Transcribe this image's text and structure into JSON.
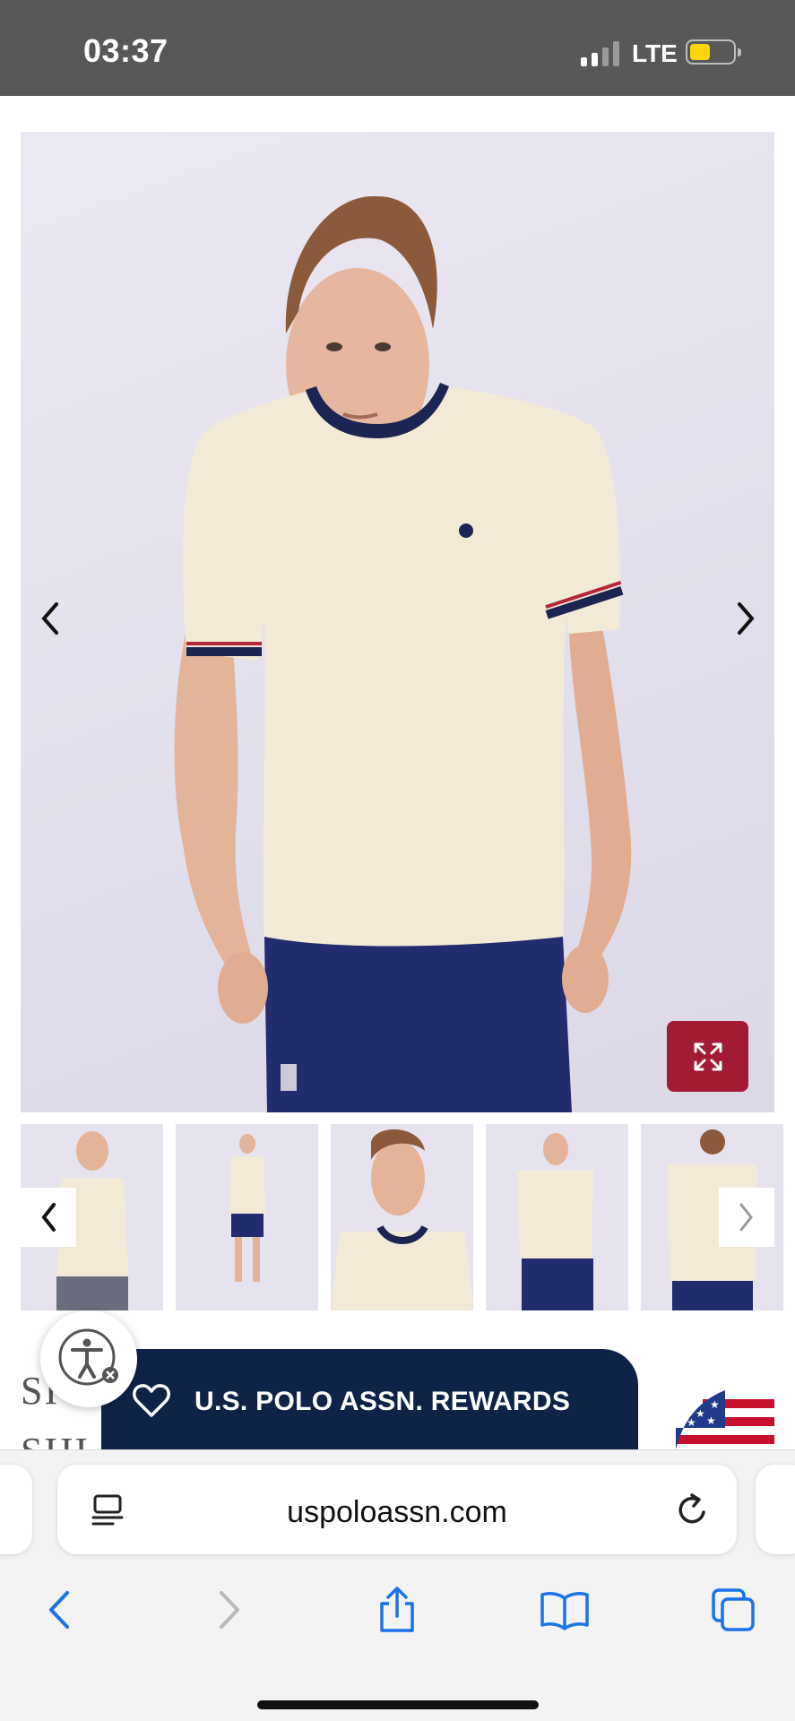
{
  "status_bar": {
    "time": "03:37",
    "network": "LTE",
    "signal_bars": 2,
    "battery_level": 0.4,
    "battery_color": "#ffd60a"
  },
  "product_gallery": {
    "main_image": "man-in-cream-ringer-tshirt-navy-shorts",
    "prev_icon": "chevron-left-icon",
    "next_icon": "chevron-right-icon",
    "zoom_icon": "expand-icon",
    "zoom_color": "#a31a35"
  },
  "thumbnails": {
    "items": [
      "thumb-front-crop",
      "thumb-full-body",
      "thumb-closeup",
      "thumb-front-shorts",
      "thumb-back"
    ],
    "prev_icon": "chevron-left-icon",
    "next_icon": "chevron-right-icon"
  },
  "product": {
    "title": "SI                        GER T-",
    "title_line2": "SHI"
  },
  "rewards_banner": {
    "label": "U.S. POLO ASSN. REWARDS",
    "icon": "heart-icon",
    "color": "#0f2349"
  },
  "accessibility": {
    "icon": "accessibility-icon"
  },
  "locale_flag": {
    "icon": "us-flag-icon"
  },
  "browser": {
    "url": "uspoloassn.com",
    "reader_icon": "reader-icon",
    "reload_icon": "reload-icon",
    "toolbar": [
      "back-icon",
      "forward-icon",
      "share-icon",
      "bookmarks-icon",
      "tabs-icon"
    ],
    "accent": "#1a73e8"
  }
}
